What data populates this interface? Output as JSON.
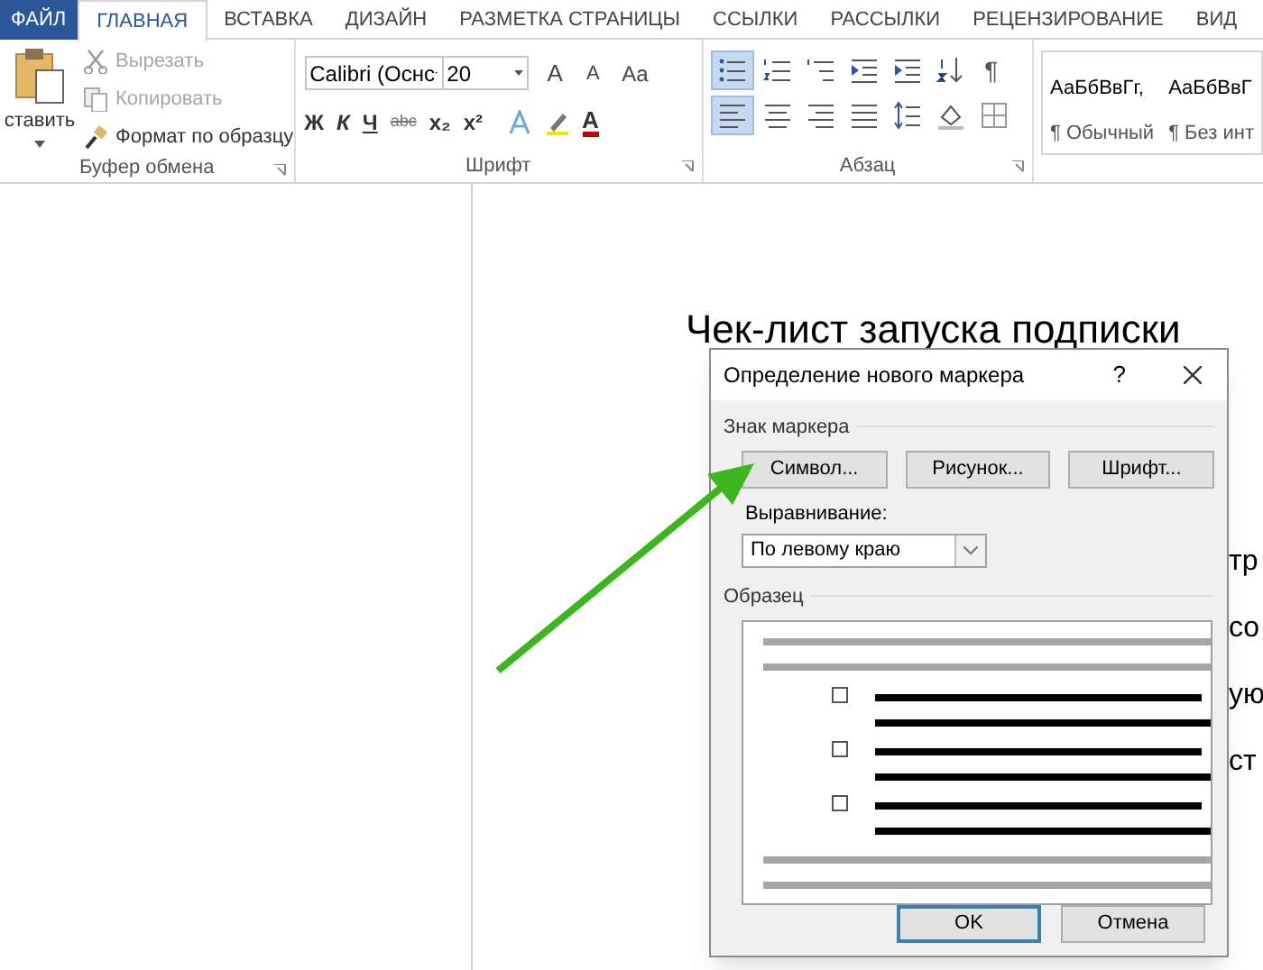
{
  "ribbon_tabs": {
    "file": "ФАЙЛ",
    "tabs": [
      {
        "label": "ГЛАВНАЯ",
        "selected": true
      },
      {
        "label": "ВСТАВКА",
        "selected": false
      },
      {
        "label": "ДИЗАЙН",
        "selected": false
      },
      {
        "label": "РАЗМЕТКА СТРАНИЦЫ",
        "selected": false
      },
      {
        "label": "ССЫЛКИ",
        "selected": false
      },
      {
        "label": "РАССЫЛКИ",
        "selected": false
      },
      {
        "label": "РЕЦЕНЗИРОВАНИЕ",
        "selected": false
      },
      {
        "label": "ВИД",
        "selected": false
      }
    ]
  },
  "clipboard": {
    "paste": "ставить",
    "items": [
      {
        "kind": "cut",
        "label": "Вырезать",
        "disabled": true
      },
      {
        "kind": "copy",
        "label": "Копировать",
        "disabled": true
      },
      {
        "kind": "painter",
        "label": "Формат по образцу",
        "disabled": false
      }
    ],
    "group_label": "Буфер обмена"
  },
  "font": {
    "font_name": "Calibri (Оснс",
    "font_size": "20",
    "grow": "A",
    "shrink": "A",
    "change_case": "Aa",
    "format_buttons": [
      "Ж",
      "К",
      "Ч",
      "abc",
      "x₂",
      "x²"
    ],
    "text_color": "A",
    "group_label": "Шрифт"
  },
  "paragraph": {
    "row_1": [
      {
        "kind": "bullets",
        "selected": true
      },
      {
        "kind": "numbering",
        "selected": false
      },
      {
        "kind": "multilevel",
        "selected": false
      },
      {
        "kind": "outdent",
        "selected": false
      },
      {
        "kind": "indent",
        "selected": false
      },
      {
        "kind": "sort",
        "selected": false
      }
    ],
    "show_marks": "¶",
    "row_2": [
      {
        "kind": "align-left",
        "selected": true
      },
      {
        "kind": "align-center",
        "selected": false
      },
      {
        "kind": "align-right",
        "selected": false
      },
      {
        "kind": "justify",
        "selected": false
      },
      {
        "kind": "line-spacing",
        "selected": false
      },
      {
        "kind": "shading",
        "selected": false
      },
      {
        "kind": "borders",
        "selected": false
      }
    ],
    "group_label": "Абзац"
  },
  "styles": [
    {
      "sample": "АаБбВвГг,",
      "name": "¶ Обычный"
    },
    {
      "sample": "АаБбВвГ",
      "name": "¶ Без инт"
    }
  ],
  "document": {
    "heading": "Чек-лист запуска подписки",
    "fragments": [
      "тр",
      "со",
      "ую",
      "ст"
    ]
  },
  "dialog": {
    "title": "Определение нового маркера",
    "help": "?",
    "section": "Знак маркера",
    "buttons": [
      "Символ...",
      "Рисунок...",
      "Шрифт..."
    ],
    "alignment_label": "Выравнивание:",
    "alignment_value": "По левому краю",
    "preview_label": "Образец",
    "footer": [
      {
        "label": "OK",
        "default": true
      },
      {
        "label": "Отмена",
        "default": false
      }
    ]
  }
}
